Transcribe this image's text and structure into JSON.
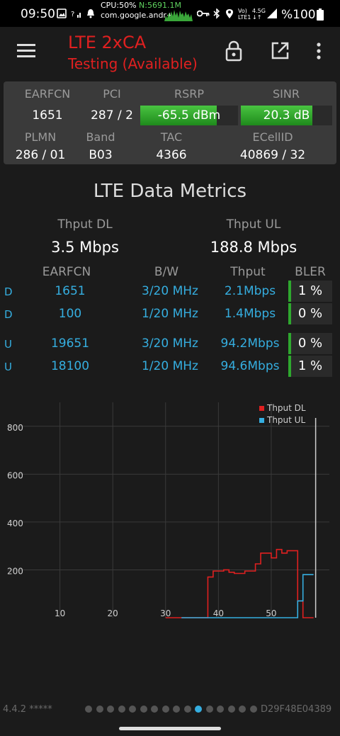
{
  "status_bar": {
    "time": "09:50",
    "cpu_label": "CPU:50%",
    "net_label": "N:5691.1M",
    "package": "com.google.andr+",
    "lte_label": "LTE1",
    "signal_4g": "4.5G",
    "battery": "%100"
  },
  "app_bar": {
    "title": "LTE 2xCA",
    "subtitle": "Testing (Available)"
  },
  "cell_info": {
    "headers": {
      "earfcn": "EARFCN",
      "pci": "PCI",
      "rsrp": "RSRP",
      "sinr": "SINR",
      "plmn": "PLMN",
      "band": "Band",
      "tac": "TAC",
      "ecellid": "ECellID"
    },
    "earfcn": "1651",
    "pci": "287 / 2",
    "rsrp": "-65.5 dBm",
    "rsrp_level": 0.78,
    "sinr": "20.3 dB",
    "sinr_level": 0.78,
    "plmn": "286 / 01",
    "band": "B03",
    "tac": "4366",
    "ecellid": "40869 / 32"
  },
  "metrics": {
    "title": "LTE Data Metrics",
    "thput_dl_label": "Thput DL",
    "thput_dl": "3.5 Mbps",
    "thput_ul_label": "Thput UL",
    "thput_ul": "188.8 Mbps",
    "columns": {
      "earfcn": "EARFCN",
      "bw": "B/W",
      "thput": "Thput",
      "bler": "BLER"
    },
    "rows": [
      {
        "dir": "D",
        "earfcn": "1651",
        "bw": "3/20 MHz",
        "thput": "2.1Mbps",
        "bler": "1 %"
      },
      {
        "dir": "D",
        "earfcn": "100",
        "bw": "1/20 MHz",
        "thput": "1.4Mbps",
        "bler": "0 %"
      },
      {
        "dir": "U",
        "earfcn": "19651",
        "bw": "3/20 MHz",
        "thput": "94.2Mbps",
        "bler": "0 %"
      },
      {
        "dir": "U",
        "earfcn": "18100",
        "bw": "1/20 MHz",
        "thput": "94.6Mbps",
        "bler": "1 %"
      }
    ]
  },
  "chart_data": {
    "type": "line",
    "title": "",
    "xlabel": "",
    "ylabel": "",
    "x_ticks": [
      "10",
      "20",
      "30",
      "40",
      "50"
    ],
    "y_ticks": [
      "200",
      "400",
      "600",
      "800"
    ],
    "xlim": [
      0,
      61
    ],
    "ylim": [
      0,
      900
    ],
    "legend_position": "top-right",
    "series": [
      {
        "name": "Thput DL",
        "color": "#e02020",
        "points": [
          [
            30,
            0
          ],
          [
            33,
            0
          ],
          [
            34,
            0
          ],
          [
            38,
            0
          ],
          [
            38,
            170
          ],
          [
            39,
            170
          ],
          [
            39,
            195
          ],
          [
            41,
            195
          ],
          [
            41,
            200
          ],
          [
            42,
            200
          ],
          [
            42,
            190
          ],
          [
            43,
            190
          ],
          [
            43,
            185
          ],
          [
            45,
            185
          ],
          [
            45,
            195
          ],
          [
            47,
            195
          ],
          [
            47,
            225
          ],
          [
            48,
            225
          ],
          [
            48,
            270
          ],
          [
            50,
            270
          ],
          [
            50,
            250
          ],
          [
            51,
            250
          ],
          [
            51,
            285
          ],
          [
            52,
            285
          ],
          [
            52,
            270
          ],
          [
            53,
            270
          ],
          [
            53,
            280
          ],
          [
            55,
            280
          ],
          [
            55,
            70
          ],
          [
            56,
            70
          ],
          [
            56,
            0
          ],
          [
            58,
            0
          ]
        ]
      },
      {
        "name": "Thput UL",
        "color": "#35aee0",
        "points": [
          [
            33,
            0
          ],
          [
            55,
            0
          ],
          [
            55,
            70
          ],
          [
            56,
            70
          ],
          [
            56,
            180
          ],
          [
            58,
            180
          ]
        ]
      }
    ]
  },
  "footer": {
    "version": "4.4.2 *****",
    "device_id": "D29F48E04389",
    "page_count": 16,
    "active_page": 10
  }
}
